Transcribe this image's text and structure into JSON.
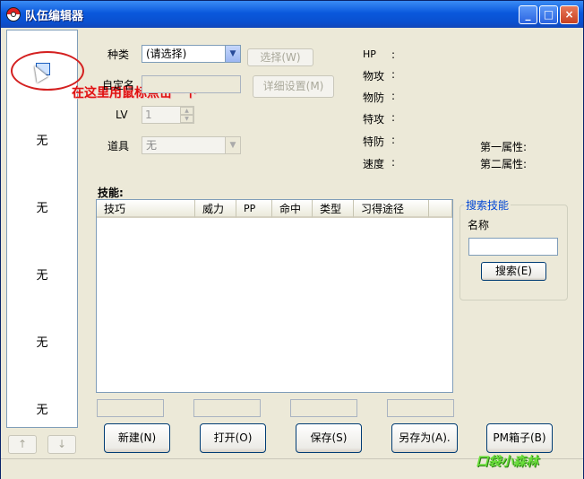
{
  "window": {
    "title": "队伍编辑器",
    "controls": {
      "minimize": "_",
      "maximize": "□",
      "close": "×"
    }
  },
  "sidebar": {
    "slots": [
      "无",
      "无",
      "无",
      "无",
      "无"
    ],
    "up_arrow": "↑",
    "down_arrow": "↓"
  },
  "annotation": {
    "text": "在这里用鼠标点击一下"
  },
  "form": {
    "species_label": "种类",
    "species_value": "(请选择)",
    "select_button": "选择(W)",
    "nickname_label": "自定名",
    "detail_button": "详细设置(M)",
    "lv_label": "LV",
    "lv_value": "1",
    "item_label": "道具",
    "item_value": "无"
  },
  "stats": {
    "hp": "HP",
    "attack": "物攻",
    "defense": "物防",
    "sp_attack": "特攻",
    "sp_defense": "特防",
    "speed": "速度",
    "colon": ":",
    "type1_label": "第一属性:",
    "type2_label": "第二属性:"
  },
  "moves": {
    "section_label": "技能:",
    "columns": [
      "技巧",
      "威力",
      "PP",
      "命中",
      "类型",
      "习得途径"
    ]
  },
  "search": {
    "group_title": "搜索技能",
    "name_label": "名称",
    "name_value": "",
    "search_button": "搜索(E)"
  },
  "actions": {
    "new": "新建(N)",
    "open": "打开(O)",
    "save": "保存(S)",
    "save_as": "另存为(A).",
    "pm_box": "PM箱子(B)"
  },
  "watermark": "口袋小森林"
}
